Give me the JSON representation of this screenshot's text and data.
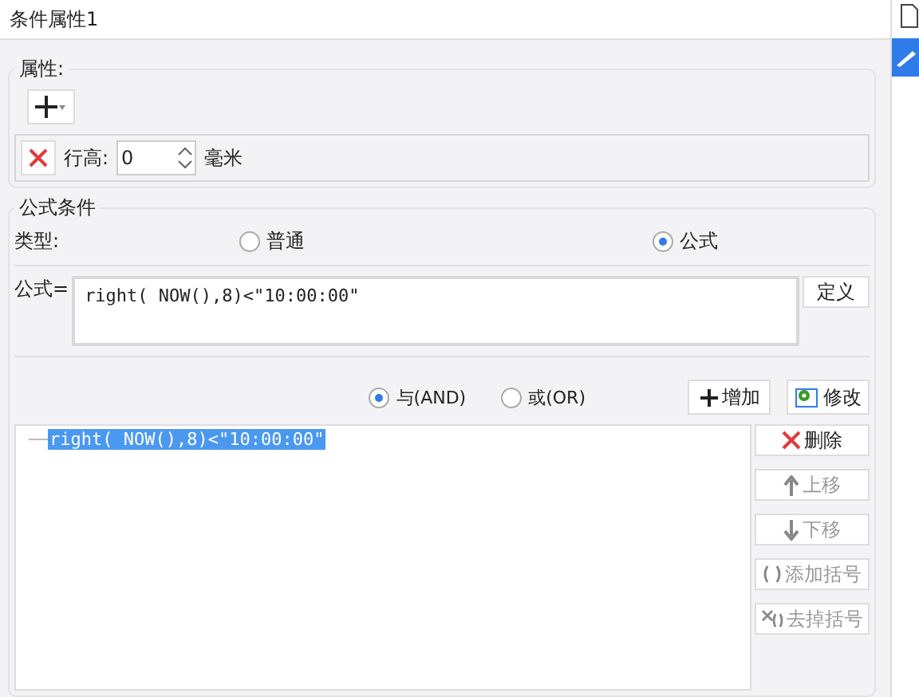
{
  "window": {
    "title": "条件属性1"
  },
  "attributes": {
    "legend": "属性:",
    "row": {
      "label": "行高:",
      "value": "0",
      "unit": "毫米"
    }
  },
  "condition": {
    "legend": "公式条件",
    "type_label": "类型:",
    "types": [
      {
        "label": "普通",
        "selected": false
      },
      {
        "label": "公式",
        "selected": true
      }
    ],
    "formula_label": "公式=",
    "formula": "right( NOW(),8)<\"10:00:00\"",
    "define_button": "定义",
    "logic": [
      {
        "label": "与(AND)",
        "selected": true
      },
      {
        "label": "或(OR)",
        "selected": false
      }
    ],
    "actions": [
      {
        "kind": "add",
        "label": "增加"
      },
      {
        "kind": "edit",
        "label": "修改"
      }
    ],
    "items": [
      {
        "label": "right( NOW(),8)<\"10:00:00\"",
        "selected": true
      }
    ],
    "side_buttons": [
      {
        "kind": "delete",
        "label": "删除",
        "disabled": false
      },
      {
        "kind": "up",
        "label": "上移",
        "disabled": true
      },
      {
        "kind": "down",
        "label": "下移",
        "disabled": true
      },
      {
        "kind": "paren",
        "label": "添加括号",
        "disabled": true
      },
      {
        "kind": "unparen",
        "label": "去掉括号",
        "disabled": true
      }
    ]
  }
}
